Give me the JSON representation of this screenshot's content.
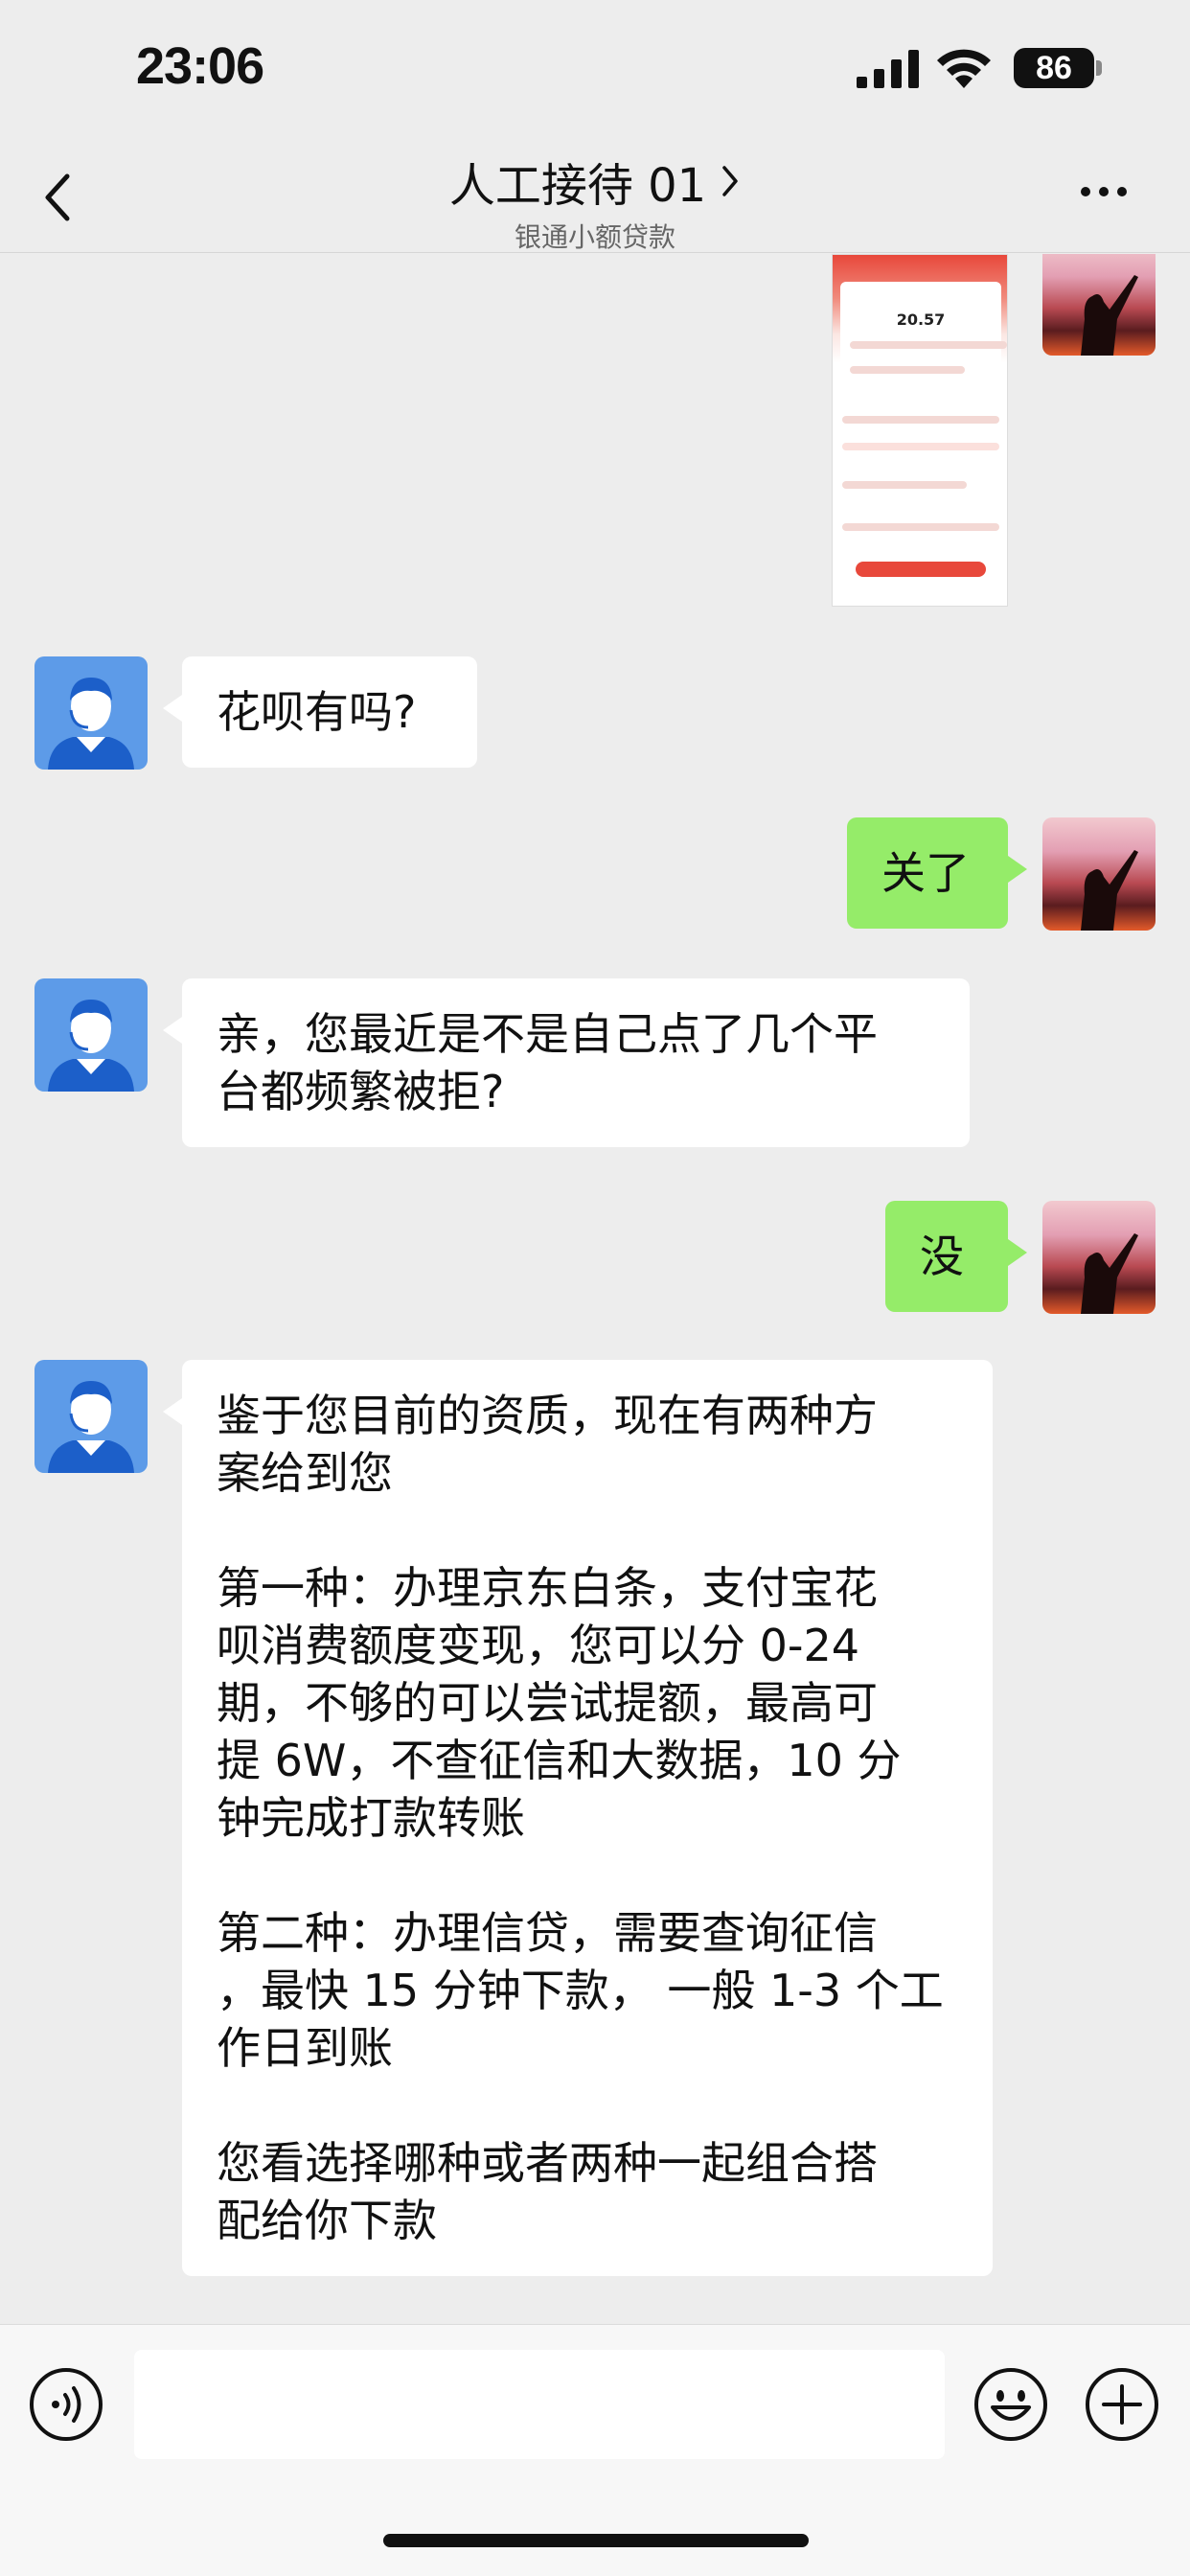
{
  "status_bar": {
    "time": "23:06",
    "battery": "86",
    "icons": [
      "signal-icon",
      "wifi-icon",
      "battery-icon"
    ]
  },
  "nav": {
    "back_icon": "chevron-left-icon",
    "title": "人工接待 01",
    "title_icon": "chevron-right-icon",
    "subtitle": "银通小额贷款",
    "more_icon": "more-icon"
  },
  "thumbnail": {
    "amount": "20.57"
  },
  "messages": [
    {
      "sender": "agent",
      "text": "花呗有吗?"
    },
    {
      "sender": "user",
      "text": "关了"
    },
    {
      "sender": "agent",
      "text": "亲，您最近是不是自己点了几个平\n台都频繁被拒?"
    },
    {
      "sender": "user",
      "text": "没"
    },
    {
      "sender": "agent",
      "text": "鉴于您目前的资质，现在有两种方\n案给到您\n\n第一种：办理京东白条，支付宝花\n呗消费额度变现，您可以分 0-24\n期，不够的可以尝试提额，最高可\n提 6W，不查征信和大数据，10 分\n钟完成打款转账\n\n第二种：办理信贷，需要查询征信\n，最快 15 分钟下款， 一般 1-3 个工\n作日到账\n\n您看选择哪种或者两种一起组合搭\n配给你下款"
    }
  ],
  "input_bar": {
    "voice_icon": "voice-icon",
    "emoji_icon": "emoji-icon",
    "add_icon": "plus-icon",
    "placeholder": ""
  },
  "colors": {
    "background": "#ededed",
    "bubble_out": "#95ec69",
    "bubble_in": "#ffffff",
    "agent_avatar": "#5d9be8"
  }
}
